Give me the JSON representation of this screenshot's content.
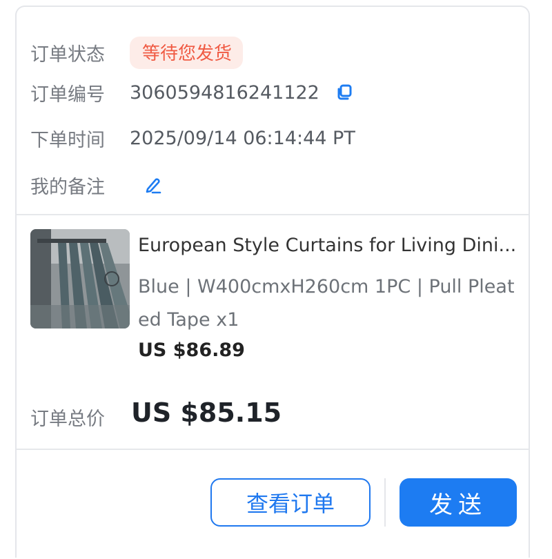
{
  "order": {
    "status_label": "订单状态",
    "status_value": "等待您发货",
    "number_label": "订单编号",
    "number_value": "3060594816241122",
    "time_label": "下单时间",
    "time_value": "2025/09/14 06:14:44 PT",
    "note_label": "我的备注"
  },
  "icons": {
    "copy": "copy-icon",
    "edit": "pencil-icon"
  },
  "product": {
    "title": "European Style Curtains for Living Dini...",
    "spec": "Blue | W400cmxH260cm 1PC | Pull Pleated Tape x1",
    "price": "US $86.89"
  },
  "total": {
    "label": "订单总价",
    "value": "US $85.15"
  },
  "actions": {
    "view_order": "查看订单",
    "send": "发送"
  },
  "colors": {
    "accent": "#1d7cf2",
    "status_text": "#f05a43",
    "status_bg": "#fdece8"
  }
}
